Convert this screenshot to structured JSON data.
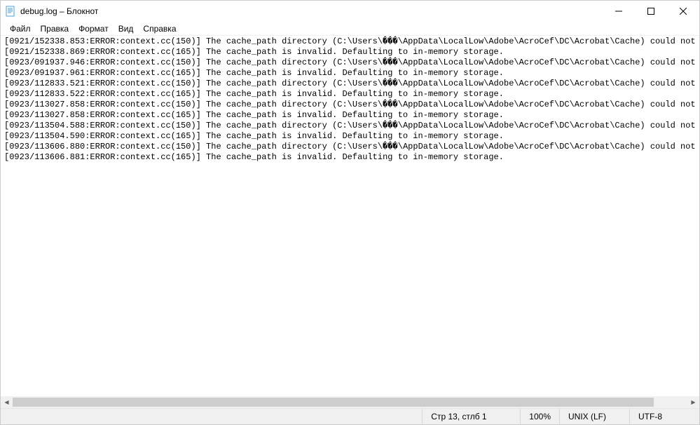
{
  "window": {
    "title": "debug.log – Блокнот"
  },
  "menu": {
    "file": "Файл",
    "edit": "Правка",
    "format": "Формат",
    "view": "Вид",
    "help": "Справка"
  },
  "log": {
    "lines": [
      "[0921/152338.853:ERROR:context.cc(150)] The cache_path directory (C:\\Users\\���\\AppData\\LocalLow\\Adobe\\AcroCef\\DC\\Acrobat\\Cache) could not be created.",
      "[0921/152338.869:ERROR:context.cc(165)] The cache_path is invalid. Defaulting to in-memory storage.",
      "[0923/091937.946:ERROR:context.cc(150)] The cache_path directory (C:\\Users\\���\\AppData\\LocalLow\\Adobe\\AcroCef\\DC\\Acrobat\\Cache) could not be created.",
      "[0923/091937.961:ERROR:context.cc(165)] The cache_path is invalid. Defaulting to in-memory storage.",
      "[0923/112833.521:ERROR:context.cc(150)] The cache_path directory (C:\\Users\\���\\AppData\\LocalLow\\Adobe\\AcroCef\\DC\\Acrobat\\Cache) could not be created.",
      "[0923/112833.522:ERROR:context.cc(165)] The cache_path is invalid. Defaulting to in-memory storage.",
      "[0923/113027.858:ERROR:context.cc(150)] The cache_path directory (C:\\Users\\���\\AppData\\LocalLow\\Adobe\\AcroCef\\DC\\Acrobat\\Cache) could not be created.",
      "[0923/113027.858:ERROR:context.cc(165)] The cache_path is invalid. Defaulting to in-memory storage.",
      "[0923/113504.588:ERROR:context.cc(150)] The cache_path directory (C:\\Users\\���\\AppData\\LocalLow\\Adobe\\AcroCef\\DC\\Acrobat\\Cache) could not be created.",
      "[0923/113504.590:ERROR:context.cc(165)] The cache_path is invalid. Defaulting to in-memory storage.",
      "[0923/113606.880:ERROR:context.cc(150)] The cache_path directory (C:\\Users\\���\\AppData\\LocalLow\\Adobe\\AcroCef\\DC\\Acrobat\\Cache) could not be created.",
      "[0923/113606.881:ERROR:context.cc(165)] The cache_path is invalid. Defaulting to in-memory storage."
    ]
  },
  "status": {
    "position": "Стр 13, стлб 1",
    "zoom": "100%",
    "eol": "UNIX (LF)",
    "encoding": "UTF-8"
  }
}
